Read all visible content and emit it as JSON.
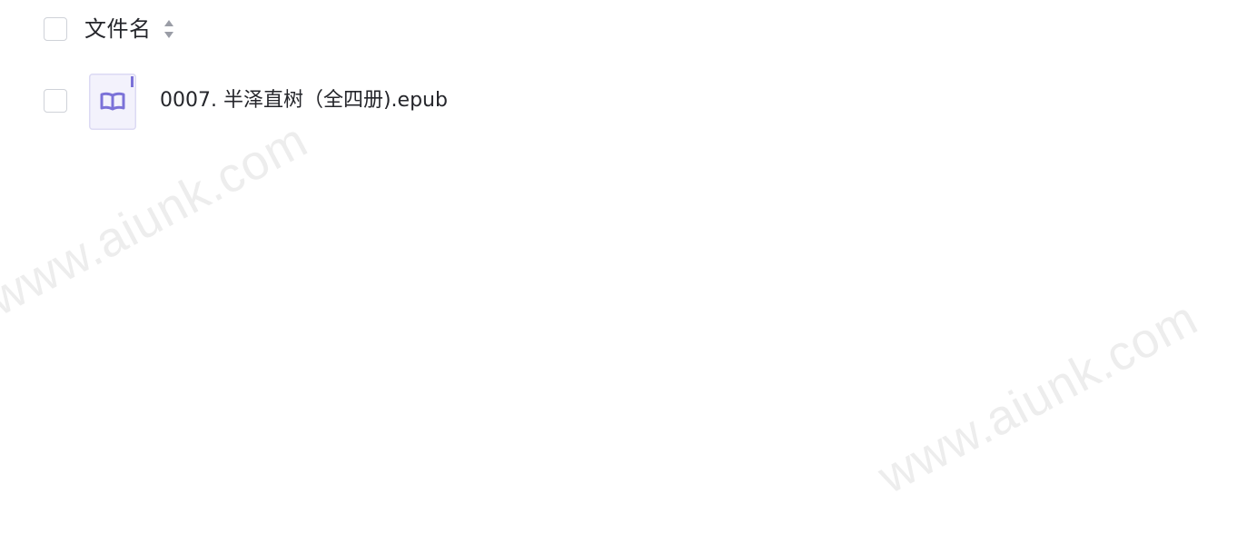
{
  "header": {
    "column_label": "文件名",
    "sort_icon": "sort-caret-icon"
  },
  "files": [
    {
      "name": "0007. 半泽直树（全四册).epub",
      "icon": "book-file-icon"
    }
  ],
  "watermark": {
    "text_1": "www.aiunk.com",
    "text_2": "www.aiunk.com"
  },
  "colors": {
    "text": "#25262b",
    "checkbox_border": "#cfd2d8",
    "icon_accent": "#7b72d8",
    "icon_bg": "#f3f2fc",
    "sort_icon": "#9a9da6",
    "watermark": "#ededed"
  }
}
